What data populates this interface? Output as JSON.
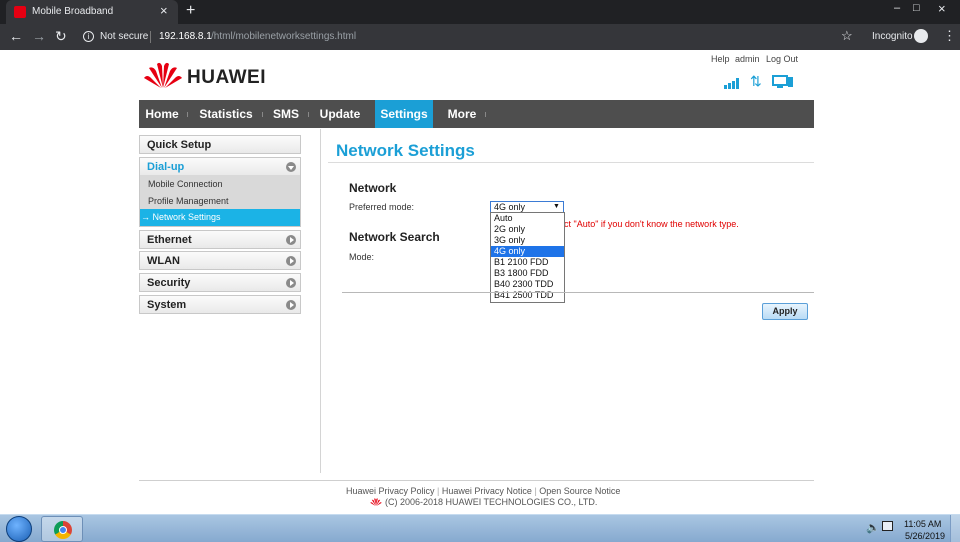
{
  "browser": {
    "tab_title": "Mobile Broadband",
    "tab_close": "×",
    "new_tab": "+",
    "security_label": "Not secure",
    "url_host": "192.168.8.1",
    "url_path": "/html/mobilenetworksettings.html",
    "profile_label": "Incognito",
    "window_controls": [
      "–",
      "□",
      "×"
    ]
  },
  "header": {
    "brand": "HUAWEI",
    "links": [
      "Help",
      "admin",
      "Log Out"
    ],
    "accent_color": "#1b9fd6"
  },
  "nav": {
    "items": [
      "Home",
      "Statistics",
      "SMS",
      "Update",
      "Settings",
      "More"
    ],
    "active": "Settings"
  },
  "sidebar": {
    "quick_setup": "Quick Setup",
    "dialup": "Dial-up",
    "dialup_items": [
      "Mobile Connection",
      "Profile Management",
      "Network Settings"
    ],
    "active_item": "Network Settings",
    "sections": [
      "Ethernet",
      "WLAN",
      "Security",
      "System"
    ]
  },
  "main": {
    "title": "Network Settings",
    "network_heading": "Network",
    "preferred_label": "Preferred mode:",
    "select_value": "4G only",
    "hint": "ct \"Auto\" if you don't know the network type.",
    "search_heading": "Network Search",
    "mode_label": "Mode:",
    "options": [
      "Auto",
      "2G only",
      "3G only",
      "4G only",
      "B1 2100 FDD",
      "B3 1800 FDD",
      "B40 2300 TDD",
      "B41 2500 TDD"
    ],
    "highlighted_option": "4G only",
    "apply_label": "Apply"
  },
  "footer": {
    "links": [
      "Huawei Privacy Policy",
      "Huawei Privacy Notice",
      "Open Source Notice"
    ],
    "copyright": "(C) 2006-2018 HUAWEI TECHNOLOGIES CO., LTD."
  },
  "taskbar": {
    "time": "11:05 AM",
    "date": "5/26/2019"
  }
}
